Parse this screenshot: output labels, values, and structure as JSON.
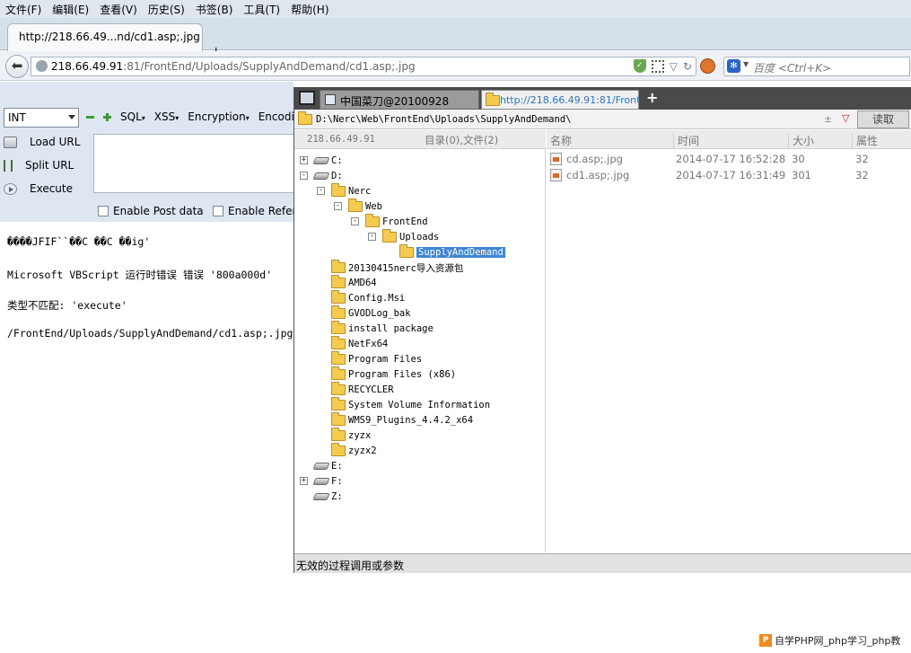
{
  "menu": [
    "文件(F)",
    "编辑(E)",
    "查看(V)",
    "历史(S)",
    "书签(B)",
    "工具(T)",
    "帮助(H)"
  ],
  "tab": {
    "title": "http://218.66.49...nd/cd1.asp;.jpg",
    "new_tab": "+"
  },
  "nav": {
    "url_host": "218.66.49.91",
    "url_rest": ":81/FrontEnd/Uploads/SupplyAndDemand/cd1.asp;.jpg",
    "search_placeholder": "百度 <Ctrl+K>"
  },
  "hackbar": {
    "select_value": "INT",
    "tools": [
      "SQL",
      "XSS",
      "Encryption",
      "Encoding"
    ],
    "actions": [
      "Load URL",
      "Split URL",
      "Execute"
    ],
    "checkboxes": [
      "Enable Post data",
      "Enable Referrer"
    ]
  },
  "page": {
    "lines": [
      "����JFIF``��C     ��C    ��ig'",
      "Microsoft VBScript 运行时错误 错误 '800a000d'",
      "类型不匹配: 'execute'",
      "/FrontEnd/Uploads/SupplyAndDemand/cd1.asp;.jpg"
    ]
  },
  "caidao": {
    "tabs": [
      "中国菜刀@20100928",
      "http://218.66.49.91:81/Front..."
    ],
    "add_tab": "+",
    "path": "D:\\Nerc\\Web\\FrontEnd\\Uploads\\SupplyAndDemand\\",
    "read_button": "读取",
    "tree_header": {
      "ip": "218.66.49.91",
      "count": "目录(0),文件(2)"
    },
    "tree": [
      {
        "label": "C:",
        "type": "drive",
        "level": 0,
        "toggle": "+"
      },
      {
        "label": "D:",
        "type": "drive",
        "level": 0,
        "toggle": "-"
      },
      {
        "label": "Nerc",
        "type": "folder",
        "level": 1,
        "toggle": "-"
      },
      {
        "label": "Web",
        "type": "folder",
        "level": 2,
        "toggle": "-"
      },
      {
        "label": "FrontEnd",
        "type": "folder",
        "level": 3,
        "toggle": "-"
      },
      {
        "label": "Uploads",
        "type": "folder",
        "level": 4,
        "toggle": "-"
      },
      {
        "label": "SupplyAndDemand",
        "type": "folder",
        "level": 5,
        "toggle": "",
        "selected": true
      },
      {
        "label": "20130415nerc导入资源包",
        "type": "folder",
        "level": 1,
        "toggle": ""
      },
      {
        "label": "AMD64",
        "type": "folder",
        "level": 1,
        "toggle": ""
      },
      {
        "label": "Config.Msi",
        "type": "folder",
        "level": 1,
        "toggle": ""
      },
      {
        "label": "GVODLog_bak",
        "type": "folder",
        "level": 1,
        "toggle": ""
      },
      {
        "label": "install package",
        "type": "folder",
        "level": 1,
        "toggle": ""
      },
      {
        "label": "NetFx64",
        "type": "folder",
        "level": 1,
        "toggle": ""
      },
      {
        "label": "Program Files",
        "type": "folder",
        "level": 1,
        "toggle": ""
      },
      {
        "label": "Program Files (x86)",
        "type": "folder",
        "level": 1,
        "toggle": ""
      },
      {
        "label": "RECYCLER",
        "type": "folder",
        "level": 1,
        "toggle": ""
      },
      {
        "label": "System Volume Information",
        "type": "folder",
        "level": 1,
        "toggle": ""
      },
      {
        "label": "WMS9_Plugins_4.4.2_x64",
        "type": "folder",
        "level": 1,
        "toggle": ""
      },
      {
        "label": "zyzx",
        "type": "folder",
        "level": 1,
        "toggle": ""
      },
      {
        "label": "zyzx2",
        "type": "folder",
        "level": 1,
        "toggle": ""
      },
      {
        "label": "E:",
        "type": "drive",
        "level": 0,
        "toggle": ""
      },
      {
        "label": "F:",
        "type": "drive",
        "level": 0,
        "toggle": "+"
      },
      {
        "label": "Z:",
        "type": "drive",
        "level": 0,
        "toggle": ""
      }
    ],
    "list_headers": [
      "名称",
      "时间",
      "大小",
      "属性"
    ],
    "files": [
      {
        "name": "cd.asp;.jpg",
        "time": "2014-07-17 16:52:28",
        "size": "30",
        "attr": "32"
      },
      {
        "name": "cd1.asp;.jpg",
        "time": "2014-07-17 16:31:49",
        "size": "301",
        "attr": "32"
      }
    ],
    "status": "无效的过程调用或参数"
  },
  "watermark": {
    "logo": "P",
    "text": "自学PHP网_php学习_php教"
  }
}
